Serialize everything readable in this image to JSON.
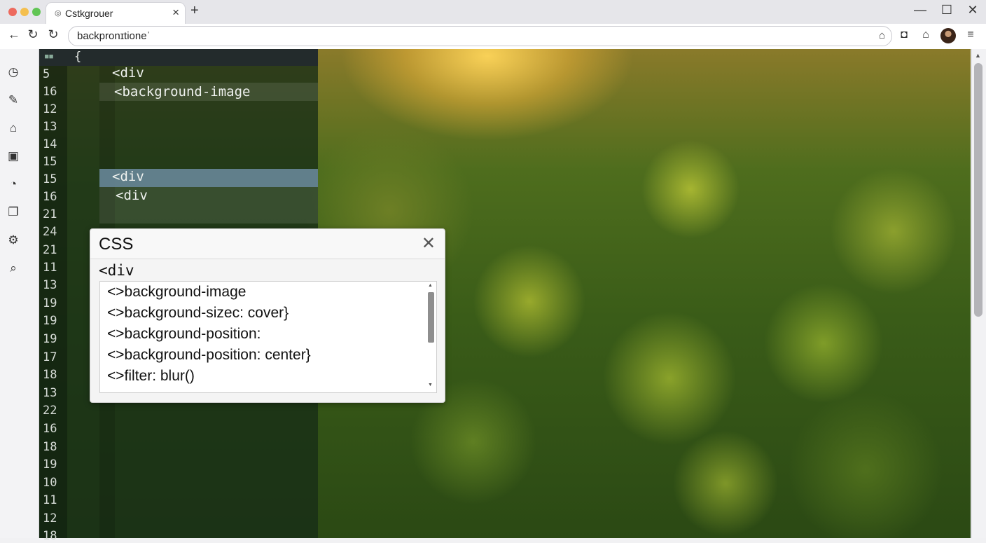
{
  "browser": {
    "tab_title": "Cstkgrouer",
    "tab_favicon": "globe-icon",
    "url": "backpronɪtioneˈ",
    "toolbar_icons": [
      "back-icon",
      "forward-icon",
      "reload-icon",
      "bookmark-icon",
      "camera-icon",
      "home-icon",
      "profile-avatar",
      "menu-icon"
    ]
  },
  "activity_bar": {
    "icons": [
      "history-icon",
      "pencil-icon",
      "home-icon",
      "calendar-icon",
      "compass-icon",
      "layers-icon",
      "gear-icon",
      "search-icon"
    ]
  },
  "editor": {
    "open_brace": "{",
    "rows": [
      {
        "num": "5",
        "code": "<div"
      },
      {
        "num": "16",
        "code": "<background-image"
      },
      {
        "num": "12",
        "code": ""
      },
      {
        "num": "13",
        "code": ""
      },
      {
        "num": "14",
        "code": ""
      },
      {
        "num": "15",
        "code": ""
      },
      {
        "num": "15",
        "code": "<div"
      },
      {
        "num": "16",
        "code": "<div"
      },
      {
        "num": "21",
        "code": ""
      },
      {
        "num": "24",
        "code": ""
      },
      {
        "num": "21",
        "code": ""
      },
      {
        "num": "11",
        "code": ""
      },
      {
        "num": "13",
        "code": ""
      },
      {
        "num": "19",
        "code": ""
      },
      {
        "num": "19",
        "code": ""
      },
      {
        "num": "19",
        "code": ""
      },
      {
        "num": "17",
        "code": ""
      },
      {
        "num": "18",
        "code": ""
      },
      {
        "num": "13",
        "code": ""
      },
      {
        "num": "22",
        "code": ""
      },
      {
        "num": "16",
        "code": ""
      },
      {
        "num": "18",
        "code": ""
      },
      {
        "num": "19",
        "code": ""
      },
      {
        "num": "10",
        "code": ""
      },
      {
        "num": "11",
        "code": ""
      },
      {
        "num": "12",
        "code": ""
      },
      {
        "num": "18",
        "code": ""
      }
    ]
  },
  "popup": {
    "title": "CSS",
    "close_label": "✕",
    "selector": "<div",
    "suggestions": [
      "<>background-image",
      "<>background-sizeᴄ: cover}",
      "<>background-position:",
      "<>background-position: center}",
      "<>filter: blur()"
    ]
  }
}
